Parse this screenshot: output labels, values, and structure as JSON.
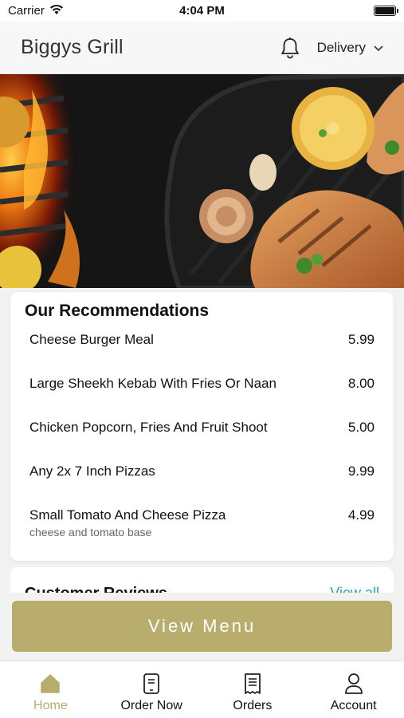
{
  "status_bar": {
    "carrier": "Carrier",
    "time": "4:04 PM"
  },
  "header": {
    "title": "Biggys Grill",
    "delivery_mode": "Delivery"
  },
  "recommendations": {
    "title": "Our Recommendations",
    "items": [
      {
        "name": "Cheese Burger Meal",
        "price": "5.99",
        "description": ""
      },
      {
        "name": "Large Sheekh Kebab With Fries Or Naan",
        "price": "8.00",
        "description": ""
      },
      {
        "name": "Chicken Popcorn, Fries And Fruit Shoot",
        "price": "5.00",
        "description": ""
      },
      {
        "name": "Any 2x 7 Inch Pizzas",
        "price": "9.99",
        "description": ""
      },
      {
        "name": "Small Tomato And Cheese Pizza",
        "price": "4.99",
        "description": "cheese and tomato base"
      }
    ]
  },
  "reviews": {
    "title": "Customer Reviews",
    "link": "View all"
  },
  "cta": {
    "label": "View Menu"
  },
  "tabs": [
    {
      "label": "Home",
      "icon": "home-icon",
      "active": true
    },
    {
      "label": "Order Now",
      "icon": "order-icon",
      "active": false
    },
    {
      "label": "Orders",
      "icon": "receipt-icon",
      "active": false
    },
    {
      "label": "Account",
      "icon": "person-icon",
      "active": false
    }
  ],
  "colors": {
    "accent": "#b9ad6d",
    "link": "#2a9fc0"
  }
}
